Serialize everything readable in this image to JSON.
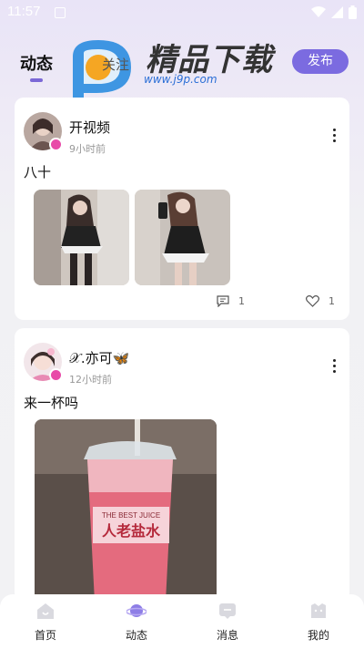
{
  "status_bar": {
    "time": "11:57"
  },
  "header": {
    "tab_active": "动态",
    "tab_follow": "关注",
    "publish_label": "发布",
    "watermark_title": "精品下载",
    "watermark_url": "www.j9p.com"
  },
  "posts": [
    {
      "username": "开视频",
      "time": "9小时前",
      "text": "八十",
      "comment_count": "1",
      "like_count": "1"
    },
    {
      "username": "𝒳.亦可🦋",
      "time": "12小时前",
      "text": "来一杯吗",
      "cup_label": "THE BEST JUICE",
      "cup_title": "人老盐水"
    }
  ],
  "nav": {
    "home": "首页",
    "feed": "动态",
    "messages": "消息",
    "mine": "我的"
  },
  "colors": {
    "accent": "#7b6be0"
  }
}
